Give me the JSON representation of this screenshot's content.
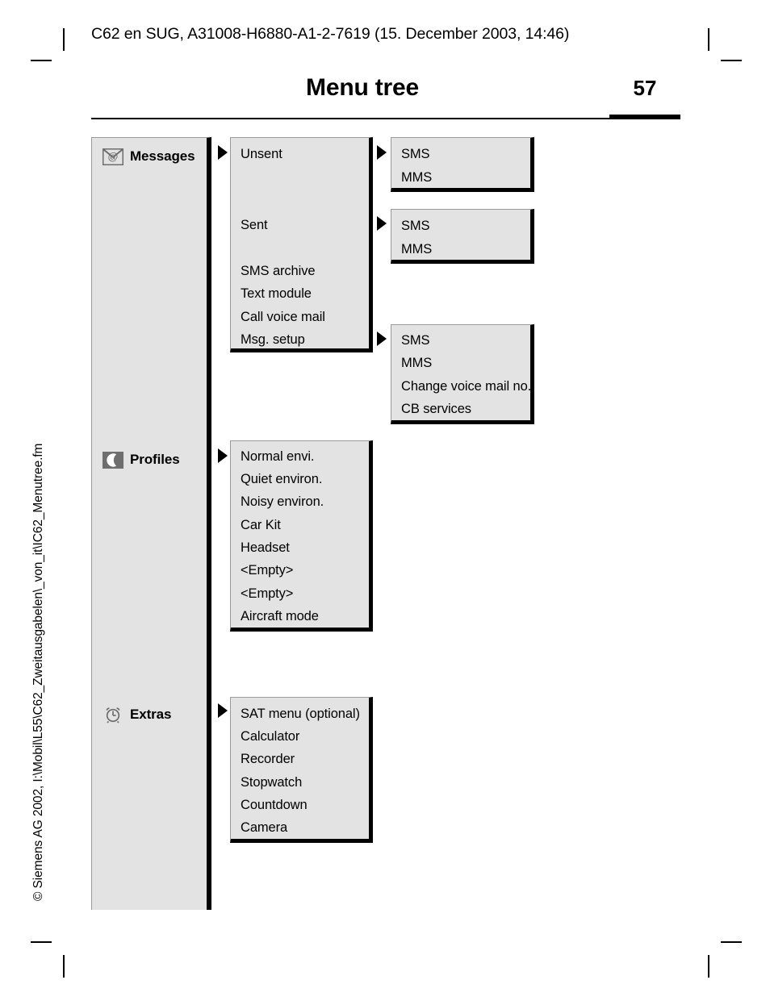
{
  "document": {
    "running_header": "C62 en SUG, A31008-H6880-A1-2-7619 (15. December 2003, 14:46)",
    "title": "Menu tree",
    "page_number": "57",
    "side_note": "© Siemens AG 2002, I:\\Mobil\\L55\\C62_Zweitausgabelen\\_von_it\\IC62_Menutree.fm"
  },
  "colors": {
    "panel_fill": "#e3e3e3",
    "panel_border": "#9b9b9b",
    "shadow": "#000000",
    "icon_gray": "#6e6e6e"
  },
  "menu_tree": {
    "roots": [
      {
        "label": "Messages",
        "icon": "envelope-at-icon"
      },
      {
        "label": "Profiles",
        "icon": "crescent-moon-icon"
      },
      {
        "label": "Extras",
        "icon": "alarm-clock-icon"
      }
    ],
    "messages": {
      "level1": [
        "Unsent",
        "Sent",
        "SMS archive",
        "Text module",
        "Call voice mail",
        "Msg. setup"
      ],
      "unsent_submenu": [
        "SMS",
        "MMS"
      ],
      "sent_submenu": [
        "SMS",
        "MMS"
      ],
      "msg_setup_submenu": [
        "SMS",
        "MMS",
        "Change voice mail no.",
        "CB services"
      ]
    },
    "profiles": {
      "level1": [
        "Normal envi.",
        "Quiet environ.",
        "Noisy environ.",
        "Car Kit",
        "Headset",
        "<Empty>",
        "<Empty>",
        "Aircraft mode"
      ]
    },
    "extras": {
      "level1": [
        "SAT menu (optional)",
        "Calculator",
        "Recorder",
        "Stopwatch",
        "Countdown",
        "Camera"
      ]
    }
  }
}
